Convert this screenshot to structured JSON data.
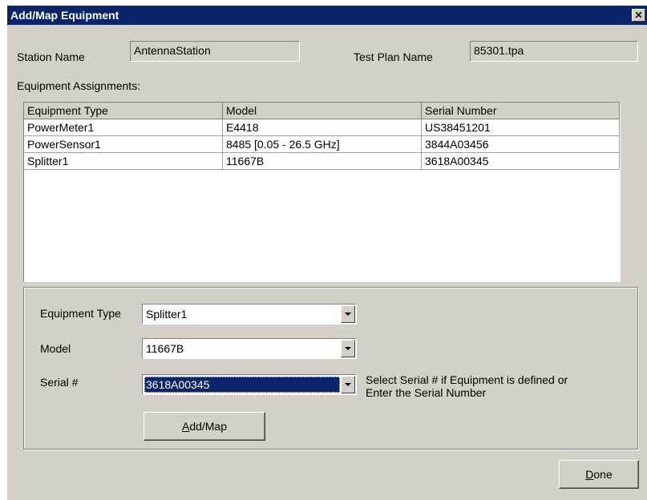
{
  "window": {
    "title": "Add/Map Equipment",
    "close_glyph": "✕"
  },
  "header": {
    "station_name_label": "Station Name",
    "station_name_value": "AntennaStation",
    "test_plan_label": "Test Plan Name",
    "test_plan_value": "85301.tpa"
  },
  "assignments": {
    "label": "Equipment Assignments:",
    "columns": [
      "Equipment Type",
      "Model",
      "Serial Number"
    ],
    "rows": [
      [
        "PowerMeter1",
        "E4418",
        "US38451201"
      ],
      [
        "PowerSensor1",
        "8485 [0.05 - 26.5 GHz]",
        "3844A03456"
      ],
      [
        "Splitter1",
        "11667B",
        "3618A00345"
      ]
    ]
  },
  "form": {
    "equipment_type_label": "Equipment Type",
    "equipment_type_value": "Splitter1",
    "model_label": "Model",
    "model_value": "11667B",
    "serial_label": "Serial #",
    "serial_value": "3618A00345",
    "serial_hint_line1": "Select Serial # if Equipment is defined or",
    "serial_hint_line2": "Enter the Serial Number",
    "add_map_button": {
      "mnemonic": "A",
      "rest": "dd/Map"
    }
  },
  "footer": {
    "done_button": {
      "mnemonic": "D",
      "rest": "one"
    }
  },
  "colors": {
    "titlebar": "#0a246a",
    "face": "#d4d0c8",
    "selection": "#0a246a"
  }
}
